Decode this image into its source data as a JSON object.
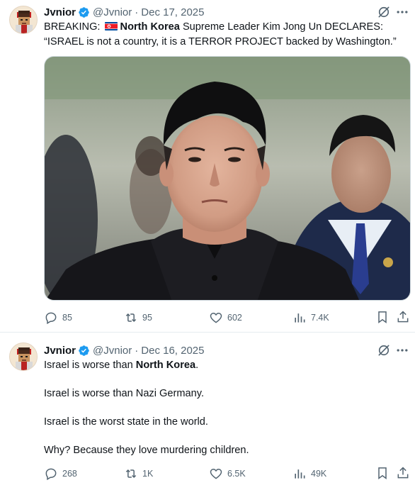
{
  "tweets": [
    {
      "author": "Jvnior",
      "handle": "@Jvnior",
      "date": "Dec 17, 2025",
      "text": {
        "line1_prefix": "BREAKING:",
        "flag_icon": "north-korea-flag",
        "line1_bold": "North Korea",
        "line1_rest": "Supreme Leader Kim Jong Un DECLARES:",
        "line2": "“ISRAEL is not a country, it is a TERROR PROJECT backed by Washington.”"
      },
      "stats": {
        "replies": "85",
        "reposts": "95",
        "likes": "602",
        "views": "7.4K"
      }
    },
    {
      "author": "Jvnior",
      "handle": "@Jvnior",
      "date": "Dec 16, 2025",
      "text": {
        "p1_prefix": "Israel is worse than",
        "p1_bold": "North Korea",
        "p1_suffix": ".",
        "p2": "Israel is worse than Nazi Germany.",
        "p3": "Israel is the worst state in the world.",
        "p4": "Why? Because they love murdering children."
      },
      "stats": {
        "replies": "268",
        "reposts": "1K",
        "likes": "6.5K",
        "views": "49K"
      }
    }
  ],
  "colors": {
    "text": "#0f1419",
    "muted": "#536471",
    "verified": "#1d9bf0",
    "border": "#cfd9de"
  },
  "separator": "·"
}
